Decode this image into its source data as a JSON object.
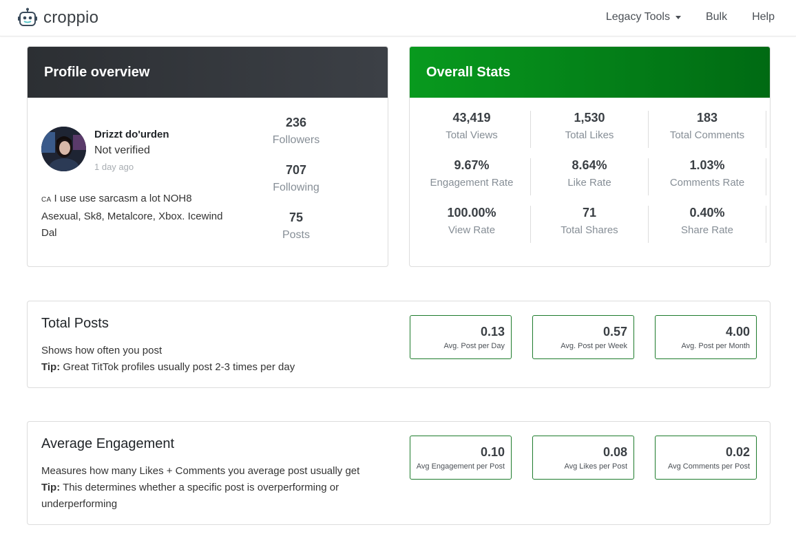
{
  "nav": {
    "brand": "croppio",
    "links": [
      "Legacy Tools",
      "Bulk",
      "Help"
    ]
  },
  "profile": {
    "header": "Profile overview",
    "name": "Drizzt do'urden",
    "verified": "Not verified",
    "time": "1 day ago",
    "bio_flag": "CA",
    "bio": "I use use sarcasm a lot NOH8 Asexual, Sk8, Metalcore, Xbox. Icewind Dal",
    "stats": [
      {
        "value": "236",
        "label": "Followers"
      },
      {
        "value": "707",
        "label": "Following"
      },
      {
        "value": "75",
        "label": "Posts"
      }
    ]
  },
  "overall": {
    "header": "Overall Stats",
    "stats": [
      {
        "value": "43,419",
        "label": "Total Views"
      },
      {
        "value": "1,530",
        "label": "Total Likes"
      },
      {
        "value": "183",
        "label": "Total Comments"
      },
      {
        "value": "9.67%",
        "label": "Engagement Rate"
      },
      {
        "value": "8.64%",
        "label": "Like Rate"
      },
      {
        "value": "1.03%",
        "label": "Comments Rate"
      },
      {
        "value": "100.00%",
        "label": "View Rate"
      },
      {
        "value": "71",
        "label": "Total Shares"
      },
      {
        "value": "0.40%",
        "label": "Share Rate"
      }
    ]
  },
  "posts": {
    "title": "Total Posts",
    "desc": "Shows how often you post",
    "tip_label": "Tip:",
    "tip": "Great TitTok profiles usually post 2-3 times per day",
    "metrics": [
      {
        "value": "0.13",
        "label": "Avg. Post per Day"
      },
      {
        "value": "0.57",
        "label": "Avg. Post per Week"
      },
      {
        "value": "4.00",
        "label": "Avg. Post per Month"
      }
    ]
  },
  "engagement": {
    "title": "Average Engagement",
    "desc": "Measures how many Likes + Comments you average post usually get",
    "tip_label": "Tip:",
    "tip": "This determines whether a specific post is overperforming or underperforming",
    "metrics": [
      {
        "value": "0.10",
        "label": "Avg Engagement per Post"
      },
      {
        "value": "0.08",
        "label": "Avg Likes per Post"
      },
      {
        "value": "0.02",
        "label": "Avg Comments per Post"
      }
    ]
  },
  "colors": {
    "accent_green": "#089a1e",
    "dark_header": "#2c2f33",
    "metric_border": "#1c7a2a"
  }
}
